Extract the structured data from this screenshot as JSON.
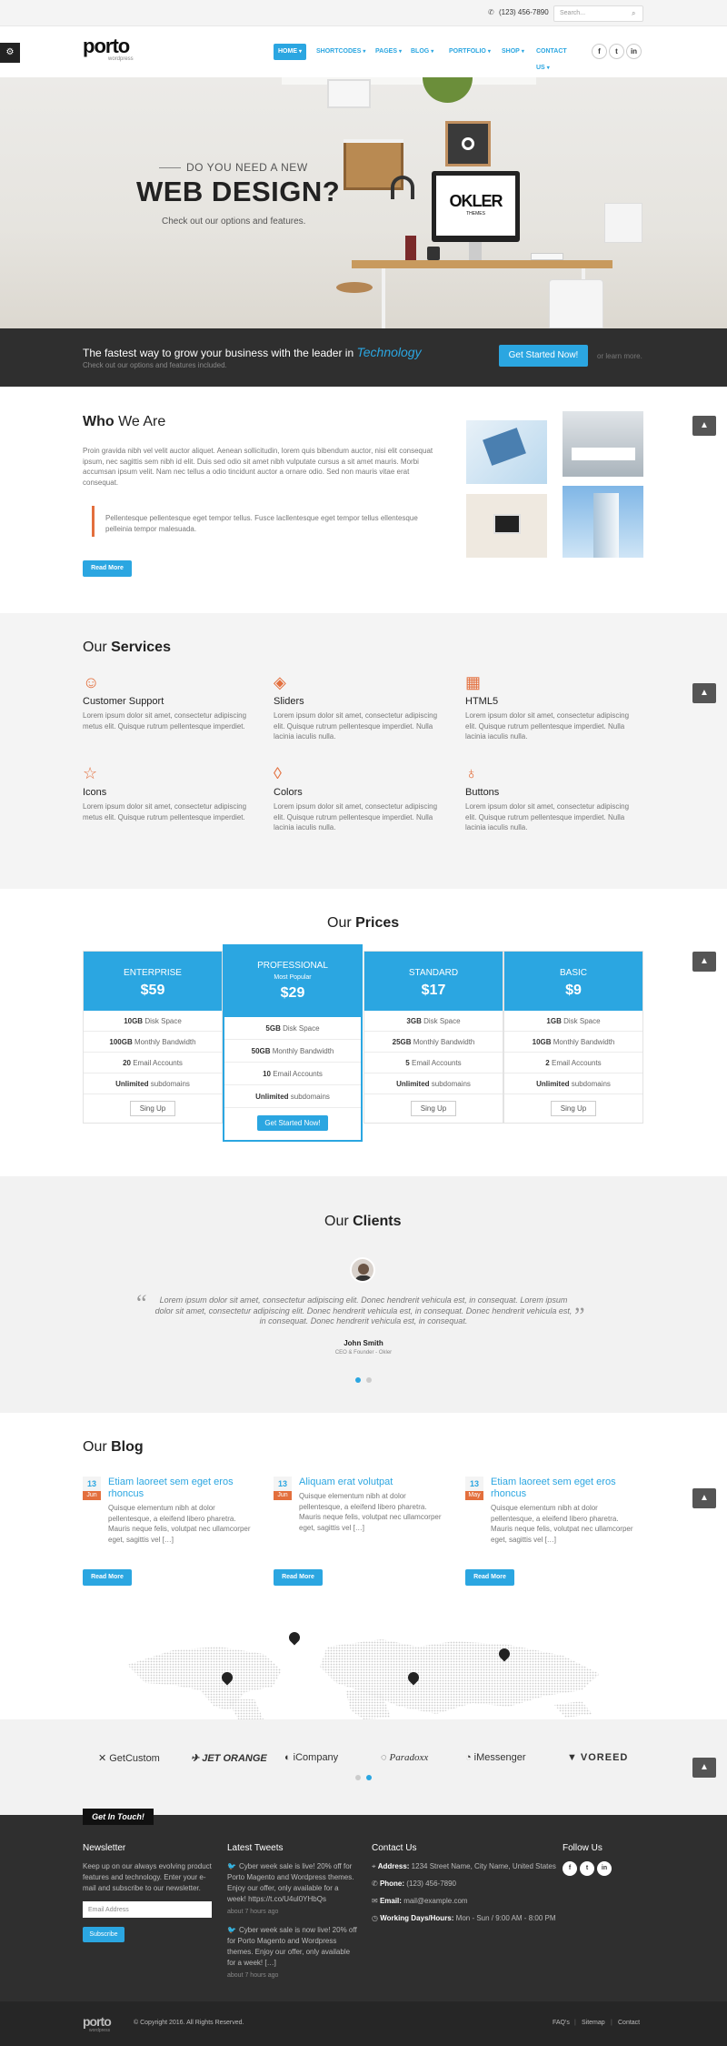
{
  "topbar": {
    "phone": "(123) 456-7890",
    "search_placeholder": "Search..."
  },
  "brand": {
    "logo": "porto",
    "tagline": "wordpress"
  },
  "nav": [
    "HOME",
    "SHORTCODES",
    "PAGES",
    "BLOG",
    "PORTFOLIO",
    "SHOP",
    "CONTACT US"
  ],
  "social": [
    "f",
    "t",
    "in"
  ],
  "hero": {
    "kicker": "DO YOU NEED A NEW",
    "title": "WEB DESIGN?",
    "subtitle": "Check out our options and features.",
    "screen_brand": "OKLER",
    "screen_sub": "THEMES"
  },
  "cta": {
    "headline": "The fastest way to grow your business with the leader in",
    "highlight": "Technology",
    "sub": "Check out our options and features included.",
    "button": "Get Started Now!",
    "alt": "or learn more."
  },
  "about": {
    "title_a": "Who",
    "title_b": "We Are",
    "body": "Proin gravida nibh vel velit auctor aliquet. Aenean sollicitudin, lorem quis bibendum auctor, nisi elit consequat ipsum, nec sagittis sem nibh id elit. Duis sed odio sit amet nibh vulputate cursus a sit amet mauris. Morbi accumsan ipsum velit. Nam nec tellus a odio tincidunt auctor a ornare odio. Sed non mauris vitae erat consequat.",
    "quote": "Pellentesque pellentesque eget tempor tellus. Fusce lacllentesque eget tempor tellus ellentesque pelleinia tempor malesuada.",
    "button": "Read More"
  },
  "services": {
    "title_a": "Our",
    "title_b": "Services",
    "items": [
      {
        "icon": "user-icon",
        "glyph": "☺",
        "name": "Customer Support",
        "text": "Lorem ipsum dolor sit amet, consectetur adipiscing metus elit. Quisque rutrum pellentesque imperdiet."
      },
      {
        "icon": "layers-icon",
        "glyph": "◈",
        "name": "Sliders",
        "text": "Lorem ipsum dolor sit amet, consectetur adipiscing elit. Quisque rutrum pellentesque imperdiet. Nulla lacinia iaculis nulla."
      },
      {
        "icon": "calculator-icon",
        "glyph": "▦",
        "name": "HTML5",
        "text": "Lorem ipsum dolor sit amet, consectetur adipiscing elit. Quisque rutrum pellentesque imperdiet. Nulla lacinia iaculis nulla."
      },
      {
        "icon": "star-icon",
        "glyph": "☆",
        "name": "Icons",
        "text": "Lorem ipsum dolor sit amet, consectetur adipiscing metus elit. Quisque rutrum pellentesque imperdiet."
      },
      {
        "icon": "drop-icon",
        "glyph": "◊",
        "name": "Colors",
        "text": "Lorem ipsum dolor sit amet, consectetur adipiscing elit. Quisque rutrum pellentesque imperdiet. Nulla lacinia iaculis nulla."
      },
      {
        "icon": "bulb-icon",
        "glyph": "♁",
        "name": "Buttons",
        "text": "Lorem ipsum dolor sit amet, consectetur adipiscing elit. Quisque rutrum pellentesque imperdiet. Nulla lacinia iaculis nulla."
      }
    ]
  },
  "prices": {
    "title_a": "Our",
    "title_b": "Prices",
    "plans": [
      {
        "name": "ENTERPRISE",
        "price": "$59",
        "disk": "10GB",
        "bw": "100GB",
        "email": "20",
        "sub": "Unlimited",
        "button": "Sing Up"
      },
      {
        "name": "PROFESSIONAL",
        "tag": "Most Popular",
        "price": "$29",
        "disk": "5GB",
        "bw": "50GB",
        "email": "10",
        "sub": "Unlimited",
        "button": "Get Started Now!"
      },
      {
        "name": "STANDARD",
        "price": "$17",
        "disk": "3GB",
        "bw": "25GB",
        "email": "5",
        "sub": "Unlimited",
        "button": "Sing Up"
      },
      {
        "name": "BASIC",
        "price": "$9",
        "disk": "1GB",
        "bw": "10GB",
        "email": "2",
        "sub": "Unlimited",
        "button": "Sing Up"
      }
    ],
    "labels": {
      "disk": "Disk Space",
      "bw": "Monthly Bandwidth",
      "email": "Email Accounts",
      "sub": "subdomains"
    }
  },
  "clients": {
    "title_a": "Our",
    "title_b": "Clients",
    "quote": "Lorem ipsum dolor sit amet, consectetur adipiscing elit. Donec hendrerit vehicula est, in consequat. Lorem ipsum dolor sit amet, consectetur adipiscing elit. Donec hendrerit vehicula est, in consequat. Donec hendrerit vehicula est, in consequat. Donec hendrerit vehicula est, in consequat.",
    "name": "John Smith",
    "role": "CEO & Founder - Okler"
  },
  "blog": {
    "title_a": "Our",
    "title_b": "Blog",
    "posts": [
      {
        "day": "13",
        "month": "Jun",
        "title": "Etiam laoreet sem eget eros rhoncus",
        "text": "Quisque elementum nibh at dolor pellentesque, a eleifend libero pharetra. Mauris neque felis, volutpat nec ullamcorper eget, sagittis vel […]",
        "button": "Read More"
      },
      {
        "day": "13",
        "month": "Jun",
        "title": "Aliquam erat volutpat",
        "text": "Quisque elementum nibh at dolor pellentesque, a eleifend libero pharetra. Mauris neque felis, volutpat nec ullamcorper eget, sagittis vel […]",
        "button": "Read More"
      },
      {
        "day": "13",
        "month": "May",
        "title": "Etiam laoreet sem eget eros rhoncus",
        "text": "Quisque elementum nibh at dolor pellentesque, a eleifend libero pharetra. Mauris neque felis, volutpat nec ullamcorper eget, sagittis vel […]",
        "button": "Read More"
      }
    ]
  },
  "logos": [
    "GetCustom",
    "JET ORANGE",
    "iCompany",
    "Paradoxx",
    "iMessenger",
    "VOREED"
  ],
  "footer": {
    "tab": "Get In Touch!",
    "newsletter": {
      "title": "Newsletter",
      "text": "Keep up on our always evolving product features and technology. Enter your e-mail and subscribe to our newsletter.",
      "placeholder": "Email Address",
      "button": "Subscribe"
    },
    "tweets": {
      "title": "Latest Tweets",
      "items": [
        {
          "text": "Cyber week sale is live! 20% off for Porto Magento and Wordpress themes. Enjoy our offer, only available for a week! https://t.co/U4ul0YHbQs",
          "time": "about 7 hours ago"
        },
        {
          "text": "Cyber week sale is now live! 20% off for Porto Magento and Wordpress themes. Enjoy our offer, only available for a week! […]",
          "time": "about 7 hours ago"
        }
      ]
    },
    "contact": {
      "title": "Contact Us",
      "address_l": "Address:",
      "address": "1234 Street Name, City Name, United States",
      "phone_l": "Phone:",
      "phone": "(123) 456-7890",
      "email_l": "Email:",
      "email": "mail@example.com",
      "hours_l": "Working Days/Hours:",
      "hours": "Mon - Sun / 9:00 AM - 8:00 PM"
    },
    "follow": {
      "title": "Follow Us"
    },
    "copyright": "© Copyright 2016. All Rights Reserved.",
    "links": [
      "FAQ's",
      "Sitemap",
      "Contact"
    ]
  },
  "colors": {
    "accent": "#2ba6e1",
    "orange": "#e36f3d",
    "dark": "#2f2f2f"
  }
}
